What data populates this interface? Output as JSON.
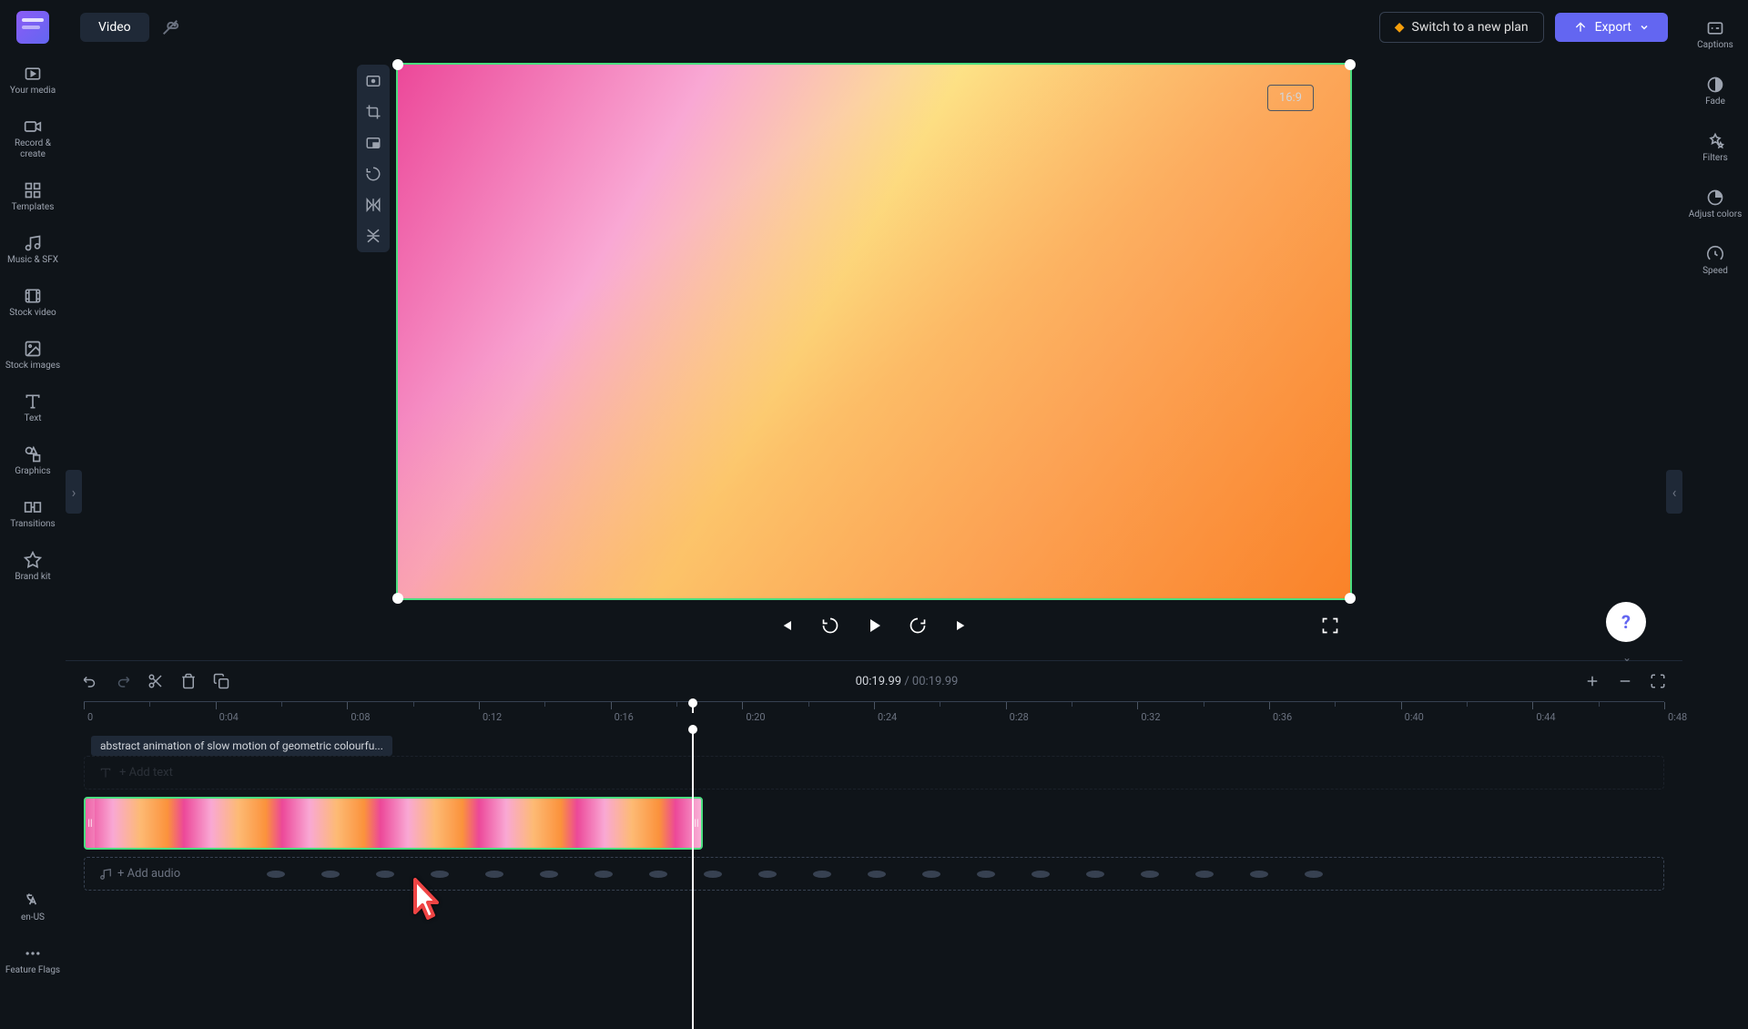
{
  "topbar": {
    "video_label": "Video",
    "switch_plan": "Switch to a new plan",
    "export": "Export"
  },
  "left_sidebar": [
    {
      "id": "your-media",
      "label": "Your media"
    },
    {
      "id": "record-create",
      "label": "Record & create"
    },
    {
      "id": "templates",
      "label": "Templates"
    },
    {
      "id": "music-sfx",
      "label": "Music & SFX"
    },
    {
      "id": "stock-video",
      "label": "Stock video"
    },
    {
      "id": "stock-images",
      "label": "Stock images"
    },
    {
      "id": "text",
      "label": "Text"
    },
    {
      "id": "graphics",
      "label": "Graphics"
    },
    {
      "id": "transitions",
      "label": "Transitions"
    },
    {
      "id": "brand-kit",
      "label": "Brand kit"
    }
  ],
  "left_bottom": [
    {
      "id": "locale",
      "label": "en-US"
    },
    {
      "id": "feature-flags",
      "label": "Feature Flags"
    }
  ],
  "right_sidebar": [
    {
      "id": "captions",
      "label": "Captions"
    },
    {
      "id": "fade",
      "label": "Fade"
    },
    {
      "id": "filters",
      "label": "Filters"
    },
    {
      "id": "adjust-colors",
      "label": "Adjust colors"
    },
    {
      "id": "speed",
      "label": "Speed"
    }
  ],
  "canvas": {
    "ratio": "16:9"
  },
  "timeline": {
    "current_time": "00:19.99",
    "total_time": "00:19.99",
    "separator": " / ",
    "ruler": [
      "0",
      "0:04",
      "0:08",
      "0:12",
      "0:16",
      "0:20",
      "0:24",
      "0:28",
      "0:32",
      "0:36",
      "0:40",
      "0:44",
      "0:48"
    ],
    "clip_tooltip": "abstract animation of slow motion of geometric colourfu...",
    "add_text": "+ Add text",
    "add_audio": "+ Add audio",
    "playhead_position_pct": 38.5
  },
  "help": "?"
}
